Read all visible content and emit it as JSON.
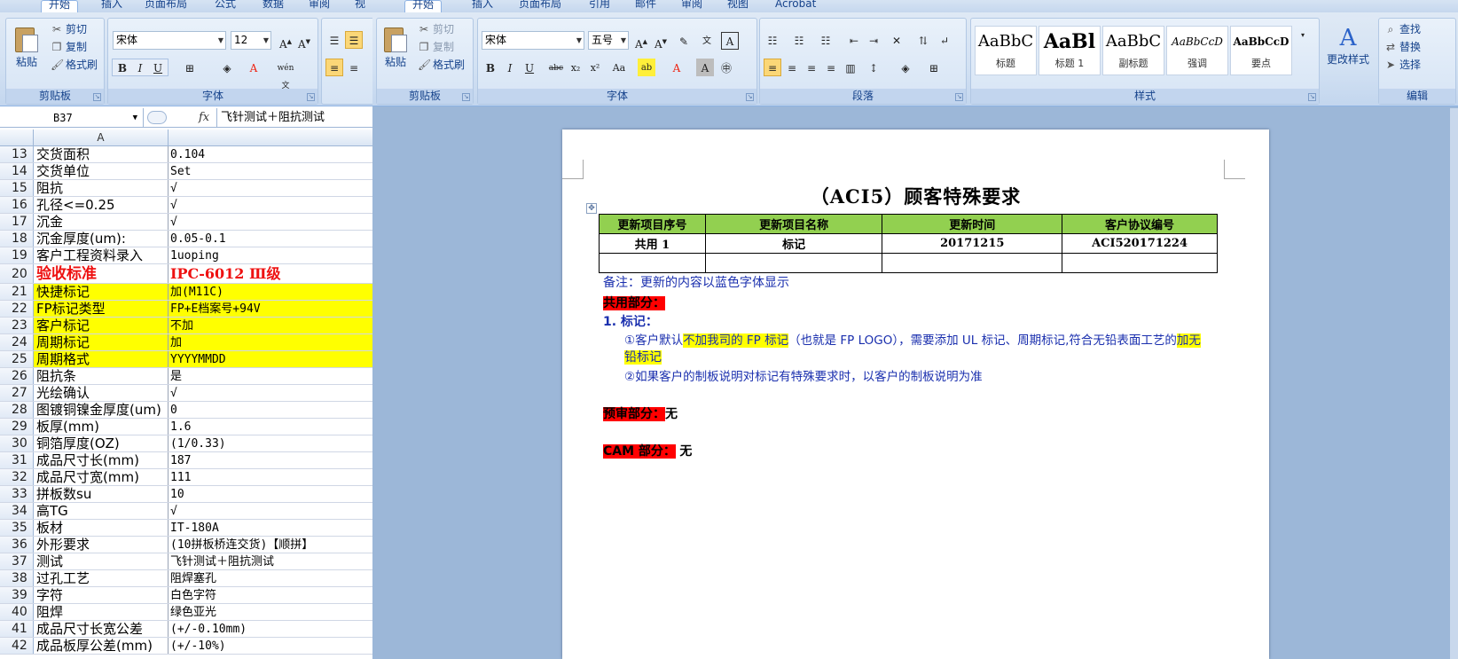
{
  "excel": {
    "tabs": [
      "开始",
      "插入",
      "页面布局",
      "公式",
      "数据",
      "审阅",
      "视"
    ],
    "clipboard": {
      "paste": "粘贴",
      "cut": "剪切",
      "copy": "复制",
      "format_painter": "格式刷",
      "label": "剪贴板"
    },
    "font": {
      "name": "宋体",
      "size": "12",
      "label": "字体",
      "wen": "wén 文"
    },
    "name_box": "B37",
    "fx": "fx",
    "formula_value": "飞针测试＋阻抗测试",
    "column_header": "A",
    "rows": [
      {
        "n": "13",
        "a": "交货面积",
        "b": "0.104"
      },
      {
        "n": "14",
        "a": "交货单位",
        "b": "Set"
      },
      {
        "n": "15",
        "a": "阻抗",
        "b": "√"
      },
      {
        "n": "16",
        "a": "孔径<=0.25",
        "b": "√"
      },
      {
        "n": "17",
        "a": "沉金",
        "b": "√"
      },
      {
        "n": "18",
        "a": "沉金厚度(um):",
        "b": "0.05-0.1"
      },
      {
        "n": "19",
        "a": "客户工程资料录入",
        "b": "1uoping"
      },
      {
        "n": "20",
        "a": "验收标准",
        "b": "IPC-6012 Ⅲ级",
        "style": "red"
      },
      {
        "n": "21",
        "a": "快捷标记",
        "b": "加(M11C)",
        "style": "yellow"
      },
      {
        "n": "22",
        "a": "FP标记类型",
        "b": "FP+E档案号+94V",
        "style": "yellow"
      },
      {
        "n": "23",
        "a": "客户标记",
        "b": "不加",
        "style": "yellow"
      },
      {
        "n": "24",
        "a": "周期标记",
        "b": "加",
        "style": "yellow"
      },
      {
        "n": "25",
        "a": "周期格式",
        "b": "YYYYMMDD",
        "style": "yellow"
      },
      {
        "n": "26",
        "a": "阻抗条",
        "b": "是"
      },
      {
        "n": "27",
        "a": "光绘确认",
        "b": "√"
      },
      {
        "n": "28",
        "a": "图镀铜镍金厚度(um)",
        "b": "0"
      },
      {
        "n": "29",
        "a": "板厚(mm)",
        "b": "1.6"
      },
      {
        "n": "30",
        "a": "铜箔厚度(OZ)",
        "b": "(1/0.33)"
      },
      {
        "n": "31",
        "a": "成品尺寸长(mm)",
        "b": "187"
      },
      {
        "n": "32",
        "a": "成品尺寸宽(mm)",
        "b": "111"
      },
      {
        "n": "33",
        "a": "拼板数su",
        "b": "10"
      },
      {
        "n": "34",
        "a": "高TG",
        "b": "√"
      },
      {
        "n": "35",
        "a": "板材",
        "b": "IT-180A"
      },
      {
        "n": "36",
        "a": "外形要求",
        "b": "(10拼板桥连交货)【顺拼】"
      },
      {
        "n": "37",
        "a": "测试",
        "b": "飞针测试＋阻抗测试"
      },
      {
        "n": "38",
        "a": "过孔工艺",
        "b": "阻焊塞孔"
      },
      {
        "n": "39",
        "a": "字符",
        "b": "白色字符"
      },
      {
        "n": "40",
        "a": "阻焊",
        "b": "绿色亚光"
      },
      {
        "n": "41",
        "a": "成品尺寸长宽公差",
        "b": "(+/-0.10mm)"
      },
      {
        "n": "42",
        "a": "成品板厚公差(mm)",
        "b": "(+/-10%)"
      }
    ]
  },
  "word": {
    "tabs": [
      "开始",
      "插入",
      "页面布局",
      "引用",
      "邮件",
      "审阅",
      "视图",
      "Acrobat"
    ],
    "clipboard": {
      "paste": "粘贴",
      "cut": "剪切",
      "copy": "复制",
      "format_painter": "格式刷",
      "label": "剪贴板"
    },
    "font": {
      "name": "宋体",
      "size": "五号",
      "label": "字体"
    },
    "paragraph_label": "段落",
    "styles": {
      "label": "样式",
      "items": [
        {
          "preview": "AaBbC",
          "name": "标题"
        },
        {
          "preview": "AaBl",
          "name": "标题 1"
        },
        {
          "preview": "AaBbC",
          "name": "副标题"
        },
        {
          "preview": "AaBbCcD",
          "name": "强调"
        },
        {
          "preview": "AaBbCcD",
          "name": "要点"
        }
      ],
      "change": "更改样式"
    },
    "editing": {
      "find": "查找",
      "replace": "替换",
      "select": "选择",
      "label": "编辑"
    },
    "doc": {
      "title": "（ACI5）顾客特殊要求",
      "table_headers": [
        "更新项目序号",
        "更新项目名称",
        "更新时间",
        "客户协议编号"
      ],
      "table_row": [
        "共用 1",
        "标记",
        "20171215",
        "ACI520171224"
      ],
      "note": "备注：更新的内容以蓝色字体显示",
      "section_common": "共用部分：",
      "item1_heading": "1. 标记：",
      "line1_prefix": "①客户默认",
      "line1_highlight": "不加我司的 FP 标记",
      "line1_mid": "（也就是 FP LOGO），需要添加 UL 标记、周期标记,符合无铅表面工艺的",
      "line1_highlight2": "加无",
      "line2_highlight": "铅标记",
      "line3": "②如果客户的制板说明对标记有特殊要求时，以客户的制板说明为准",
      "section_review": "预审部分：",
      "review_value": "无",
      "section_cam": "CAM 部分：",
      "cam_value": "无"
    }
  }
}
